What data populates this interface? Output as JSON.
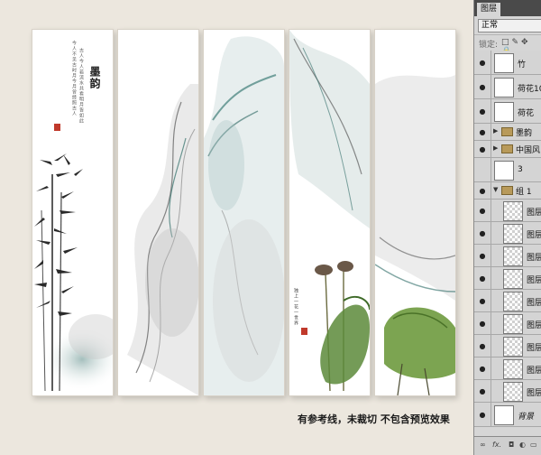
{
  "canvas": {
    "panel1": {
      "title": "墨韵",
      "poem": "今人不见古时月今月曾经照古人",
      "poem_right": "古人今人若流水共看明月皆如此"
    },
    "panel4": {
      "poem": "独上一花一世界"
    },
    "caption": "有参考线，未裁切 不包含预览效果"
  },
  "layers_panel": {
    "tab_label": "图层",
    "blend_mode": "正常",
    "lock_label": "锁定:",
    "lock_icons": "□✎✥🔒",
    "layers": [
      {
        "name": "竹",
        "type": "smart",
        "visible": true
      },
      {
        "name": "荷花10",
        "type": "smart",
        "visible": true
      },
      {
        "name": "荷花",
        "type": "smart",
        "visible": true
      },
      {
        "name": "墨韵",
        "type": "group",
        "visible": true
      },
      {
        "name": "中国风",
        "type": "group",
        "visible": true
      },
      {
        "name": "3",
        "type": "layer",
        "visible": false
      },
      {
        "name": "组 1",
        "type": "group-open",
        "visible": true
      },
      {
        "name": "图层",
        "type": "child",
        "visible": true
      },
      {
        "name": "图层",
        "type": "child",
        "visible": true
      },
      {
        "name": "图层",
        "type": "child",
        "visible": true
      },
      {
        "name": "图层",
        "type": "child",
        "visible": true
      },
      {
        "name": "图层",
        "type": "child",
        "visible": true
      },
      {
        "name": "图层",
        "type": "child",
        "visible": true
      },
      {
        "name": "图层",
        "type": "child",
        "visible": true
      },
      {
        "name": "图层",
        "type": "child",
        "visible": true
      },
      {
        "name": "图层",
        "type": "child",
        "visible": true
      },
      {
        "name": "背景",
        "type": "background",
        "visible": true
      }
    ],
    "footer_icons": [
      "link-icon",
      "fx-icon",
      "mask-icon",
      "adjust-icon",
      "folder-icon"
    ]
  }
}
